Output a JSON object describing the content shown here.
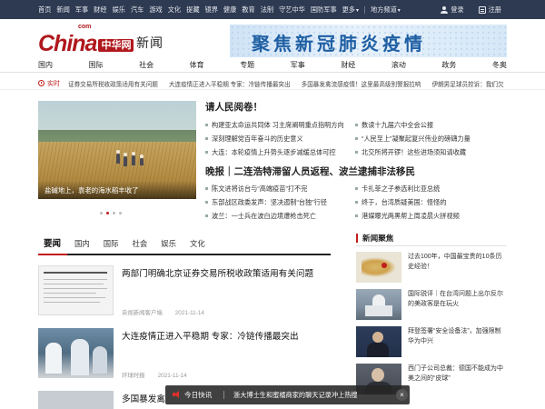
{
  "topbar": {
    "nav": [
      "首页",
      "新闻",
      "军事",
      "财经",
      "娱乐",
      "汽车",
      "游戏",
      "文化",
      "提藏",
      "镜界",
      "健康",
      "教育",
      "法制",
      "守艺中华",
      "国防军事",
      "更多",
      "地方频道"
    ],
    "login": "登录",
    "register": "注册"
  },
  "header": {
    "logo_text": "China",
    "logo_com": "com",
    "logo_cn": "中华网",
    "section": "新闻",
    "banner": "聚焦新冠肺炎疫情"
  },
  "mainnav": [
    "国内",
    "国际",
    "社会",
    "体育",
    "专题",
    "军事",
    "财经",
    "滚动",
    "政务",
    "冬奥"
  ],
  "ticker": {
    "label": "实时",
    "items": [
      "证券交易所税收政策适用有关问题",
      "大连疫情正进入平稳期 专家：冷链传播最突出",
      "多国暴发禽流感疫情！这里最高级别警报拉响",
      "伊朗男足球员控诉：我们欠"
    ]
  },
  "carousel": {
    "caption": "盐碱地上，袁老的海水稻丰收了",
    "active_dot": 2
  },
  "headlines": {
    "title1": "请人民阅卷！",
    "left1": [
      "构建亚太命运共同体 习主席阐明重点指明方向",
      "深刻理解党百年奋斗的历史意义",
      "大连：本轮疫情上升势头逐步减缓总体可控"
    ],
    "right1": [
      "数读十九届六中全会公报",
      "“人民至上”凝聚起复兴伟业的磅礴力量",
      "北交所将开锣！这些进场须知请收藏"
    ],
    "title2": "晚报｜二连浩特滞留人员返程、波兰逮捕非法移民",
    "left2": [
      "陈文进将访台与“高端疫苗”打不完",
      "东部战区政委发声：坚决遏制“台独”行径",
      "波兰：一士兵在波白边境遭枪击死亡"
    ],
    "right2": [
      "卡扎菲之子参选利比亚总统",
      "终于，台湾质疑美国：怪怪的",
      "港媒曝光两黑帮上周凌晨火拼视频"
    ]
  },
  "tabs": [
    "要闻",
    "国内",
    "国际",
    "社会",
    "娱乐",
    "文化"
  ],
  "feed": [
    {
      "title": "两部门明确北京证券交易所税收政策适用有关问题",
      "source": "央视新闻客户端",
      "date": "2021-11-14",
      "thumb": "document"
    },
    {
      "title": "大连疫情正进入平稳期 专家：冷链传播最突出",
      "source": "环球时报",
      "date": "2021-11-14",
      "thumb": "medical"
    },
    {
      "title": "多国暴发禽",
      "source": "",
      "date": "",
      "thumb": "partial"
    }
  ],
  "right_col": {
    "title": "新闻聚焦",
    "items": [
      {
        "text": "过去100年，中国最宝贵的10条历史经验！",
        "thumb": "map"
      },
      {
        "text": "国际锐评｜在台湾问题上出尔反尔的美政客是在玩火",
        "thumb": "capitol"
      },
      {
        "text": "拜登签署“安全设备法”，加强限制华为中兴",
        "thumb": "speaker"
      },
      {
        "text": "西门子公司总裁：德国不能成为中美之间的“皮球”",
        "thumb": "man"
      }
    ]
  },
  "flash": {
    "label": "今日快讯",
    "text": "浙大博士生和蜜橘商家的聊天记录冲上热搜",
    "close": "×"
  },
  "colors": {
    "brand_red": "#c21d1d",
    "topbar_bg": "#2e3a52",
    "banner_blue": "#1f5fa3"
  }
}
